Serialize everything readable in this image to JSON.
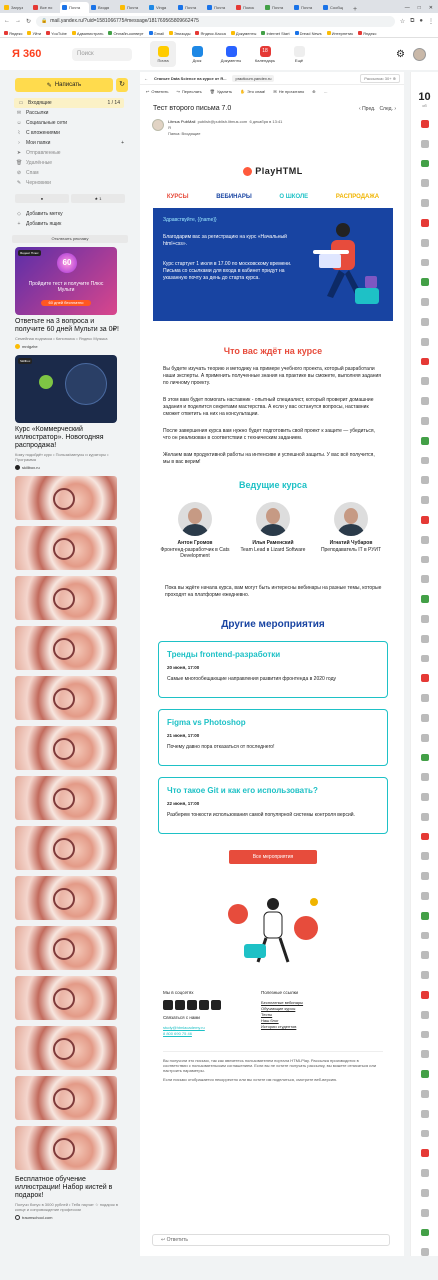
{
  "browser": {
    "tabs": [
      "Загруз",
      "Все по",
      "Почта",
      "Входя",
      "Почта",
      "Vinga",
      "Почта",
      "Почта",
      "Поиск",
      "Почта",
      "Почта",
      "Сообщ"
    ],
    "url": "mail.yandex.ru/?uid=1581066775#message/181769565809662475",
    "bookmarks": [
      "Яндекс",
      "Уйти",
      "YouTube",
      "Администрать",
      "Онлайн-конверт",
      "Gmail",
      "Эпизоды",
      "Яндекс.Касса",
      "Документы",
      "Internet Start",
      "Dread News",
      "Интернетик",
      "Яндекс"
    ]
  },
  "header": {
    "logo": "Я 360",
    "search_placeholder": "Поиск",
    "services": [
      "Почта",
      "Диск",
      "Документы",
      "Календарь",
      "Ещё"
    ],
    "calendar_day": "18"
  },
  "sidebar": {
    "write": "Написать",
    "folders": [
      {
        "icon": "inbox",
        "label": "Входящие",
        "count": "1 / 14"
      },
      {
        "icon": "mail",
        "label": "Рассылки",
        "count": ""
      },
      {
        "icon": "social",
        "label": "Социальные сети",
        "count": ""
      },
      {
        "icon": "clip",
        "label": "С вложениями",
        "count": ""
      },
      {
        "icon": "folder",
        "label": "Мои папки",
        "count": "+"
      },
      {
        "icon": "sent",
        "label": "Отправленные",
        "count": ""
      },
      {
        "icon": "trash",
        "label": "Удалённые",
        "count": ""
      },
      {
        "icon": "spam",
        "label": "Спам",
        "count": ""
      },
      {
        "icon": "draft",
        "label": "Черновики",
        "count": ""
      }
    ],
    "labels": [
      "●",
      "★ 1"
    ],
    "add_label": "Добавить метку",
    "add_box": "Добавить ящик",
    "ads_toggle": "Отключить рекламу"
  },
  "ads": [
    {
      "badge": "Яндекс Плюс",
      "overlay1": "Пройдите тест и получите Плюс Мульти",
      "overlay2": "60 дней бесплатно",
      "title": "Ответьте на 3 вопроса и получите 60 дней Мульти за 0₽!",
      "sub": "Семейная подписка • Кинопоиск • Яндекс Музыка",
      "src": "mrdgzhe"
    },
    {
      "badge": "Skillbox",
      "title": "Курс «Коммерческий иллюстратор». Новогодняя распродажа!",
      "sub": "Кому подойдёт курс • Польза/минусы и кураторы • Программа",
      "src": "skillbox.ru"
    },
    {
      "title": "Бесплатное обучение иллюстрации! Набор кистей в подарок!",
      "sub": "Получи бонус в 3000 рублей • Тебя научат ☆ подарок в конце и сопровождение профессии",
      "src": "traumschool.com"
    }
  ],
  "message": {
    "tabs": [
      "Станьте Data Science на курсе от Я...",
      "practicum.yandex.ru",
      "Рассылка• 30+ ⊕"
    ],
    "actions": [
      "Ответить",
      "Переслать",
      "Удалить",
      "Это спам!",
      "Не прочитано",
      "⊕",
      "…"
    ],
    "subject": "Тест второго письма 7.0",
    "prev": "‹ Пред.",
    "next": "След. ›",
    "from_name": "Litmus PubMail",
    "from_email": "publish@publish.litmus.com",
    "date": "6 декабря в 13:41",
    "to": "Я",
    "folder": "Папка: Входящие"
  },
  "letter": {
    "brand": "PlayHTML",
    "nav": [
      "КУРСЫ",
      "ВЕБИНАРЫ",
      "О ШКОЛЕ",
      "РАСПРОДАЖА"
    ],
    "greeting": "Здравствуйте, {{name}}",
    "hero1": "Благодарим вас за регистрацию на курс «Начальный html+css».",
    "hero2": "Курс стартует 1 июля в 17.00 по московскому времени. Письма со ссылками для входа в кабинет придут на указанную почту за день до старта курса.",
    "whats_title": "Что вас ждёт на курсе",
    "paras": [
      "Вы будете изучать теорию и методику на примере учебного проекта, который разработали наши эксперты. А применить полученные знания на практике вы сможете, выполняя задания по личному проекту.",
      "В этом вам будет помогать наставник - опытный специалист, который проверит домашние задания и поделится секретами мастерства. А если у вас останутся вопросы, наставник сможет ответить на них на консультации.",
      "После завершения курса вам нужно будет подготовить свой проект к защите — убедиться, что он реализован в соответствии с техническим заданием.",
      "Желаем вам продуктивной работы на интенсиве и успешной защиты. У вас всё получится, мы в вас верим!"
    ],
    "teachers_title": "Ведущие курса",
    "teachers": [
      {
        "name": "Антон Громов",
        "role": "Фронтенд-разработчик в Cats Development"
      },
      {
        "name": "Илья Раменский",
        "role": "Team Lead в Lizard Software"
      },
      {
        "name": "Игнатий Чубаров",
        "role": "Преподаватель IT в РУИТ"
      }
    ],
    "webinars_note": "Пока вы ждёте начала курса, вам могут быть интересны вебинары на разные темы, которые проходят на платформе ежедневно.",
    "events_title": "Другие мероприятия",
    "events": [
      {
        "title": "Тренды frontend-разработки",
        "date": "20 июня, 17:00",
        "text": "Самые многообещающие направления развития фронтенда в 2020 году"
      },
      {
        "title": "Figma vs Photoshop",
        "date": "21 июня, 17:00",
        "text": "Почему давно пора отказаться от последнего!"
      },
      {
        "title": "Что такое Git и как его использовать?",
        "date": "22 июня, 17:00",
        "text": "Разберем тонкости использования самой популярной системы контроля версий."
      }
    ],
    "all_events": "Все мероприятия",
    "footer": {
      "social_title": "Мы в соцсетях",
      "contact_title": "Связаться с нами",
      "email": "study@htmlacademy.ru",
      "phone": "8 800 690 75 46",
      "links_title": "Полезные ссылки",
      "links": [
        "Бесплатные вебинары",
        "Обучающие курсы",
        "Тесты",
        "Наш блог",
        "Истории студентов"
      ]
    },
    "fine1": "Вы получили это письмо, так как являетесь пользователем портала HTMLPlay. Рассылка производится в соответствии с пользовательским соглашением. Если вы не хотите получать рассылку, вы можете отписаться или настроить параметры.",
    "fine2": "Если письмо отображается некорректно или вы хотите им поделиться, смотрите веб-версию."
  },
  "reply": "Ответить",
  "rightbar": {
    "day": "10",
    "weekday": "сб"
  },
  "colors": {
    "accent_red": "#e74c3c",
    "teal": "#1ec1c6",
    "navy": "#1844a2",
    "yellow": "#ffdb4d"
  }
}
